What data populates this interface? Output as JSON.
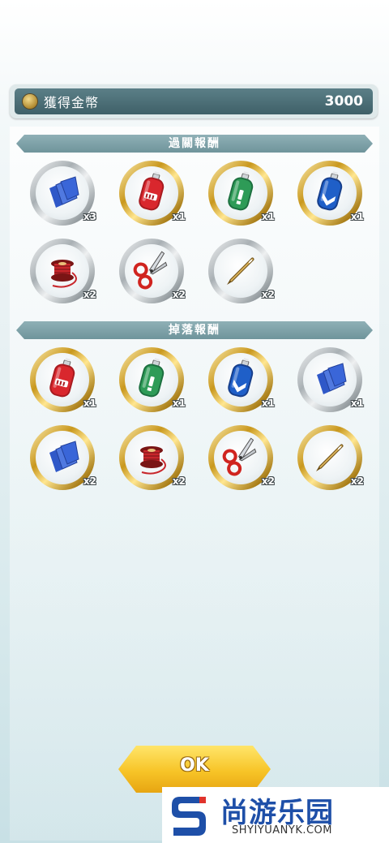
{
  "coins": {
    "label": "獲得金幣",
    "value": "3000",
    "icon": "coin-icon"
  },
  "sections": [
    {
      "title": "過關報酬"
    },
    {
      "title": "掉落報酬"
    }
  ],
  "clear_rewards": [
    {
      "icon": "cloth-icon",
      "qty": "x3",
      "frame": "silver"
    },
    {
      "icon": "red-bottle-icon",
      "qty": "x1",
      "frame": "gold"
    },
    {
      "icon": "green-bottle-icon",
      "qty": "x1",
      "frame": "gold"
    },
    {
      "icon": "blue-bottle-icon",
      "qty": "x1",
      "frame": "gold"
    },
    {
      "icon": "thread-spool-icon",
      "qty": "x2",
      "frame": "silver"
    },
    {
      "icon": "scissors-icon",
      "qty": "x2",
      "frame": "silver"
    },
    {
      "icon": "needle-icon",
      "qty": "x2",
      "frame": "silver"
    }
  ],
  "drop_rewards": [
    {
      "icon": "red-bottle-icon",
      "qty": "x1",
      "frame": "gold"
    },
    {
      "icon": "green-bottle-icon",
      "qty": "x1",
      "frame": "gold"
    },
    {
      "icon": "blue-bottle-icon",
      "qty": "x1",
      "frame": "gold"
    },
    {
      "icon": "cloth-icon",
      "qty": "x1",
      "frame": "silver"
    },
    {
      "icon": "cloth-icon",
      "qty": "x2",
      "frame": "gold"
    },
    {
      "icon": "thread-spool-icon",
      "qty": "x2",
      "frame": "gold"
    },
    {
      "icon": "scissors-icon",
      "qty": "x2",
      "frame": "gold"
    },
    {
      "icon": "needle-icon",
      "qty": "x2",
      "frame": "gold"
    }
  ],
  "ok_button": {
    "label": "OK"
  },
  "watermark": {
    "title": "尚游乐园",
    "url": "SHYIYUANYK.COM",
    "color": "#1e4fa8"
  }
}
